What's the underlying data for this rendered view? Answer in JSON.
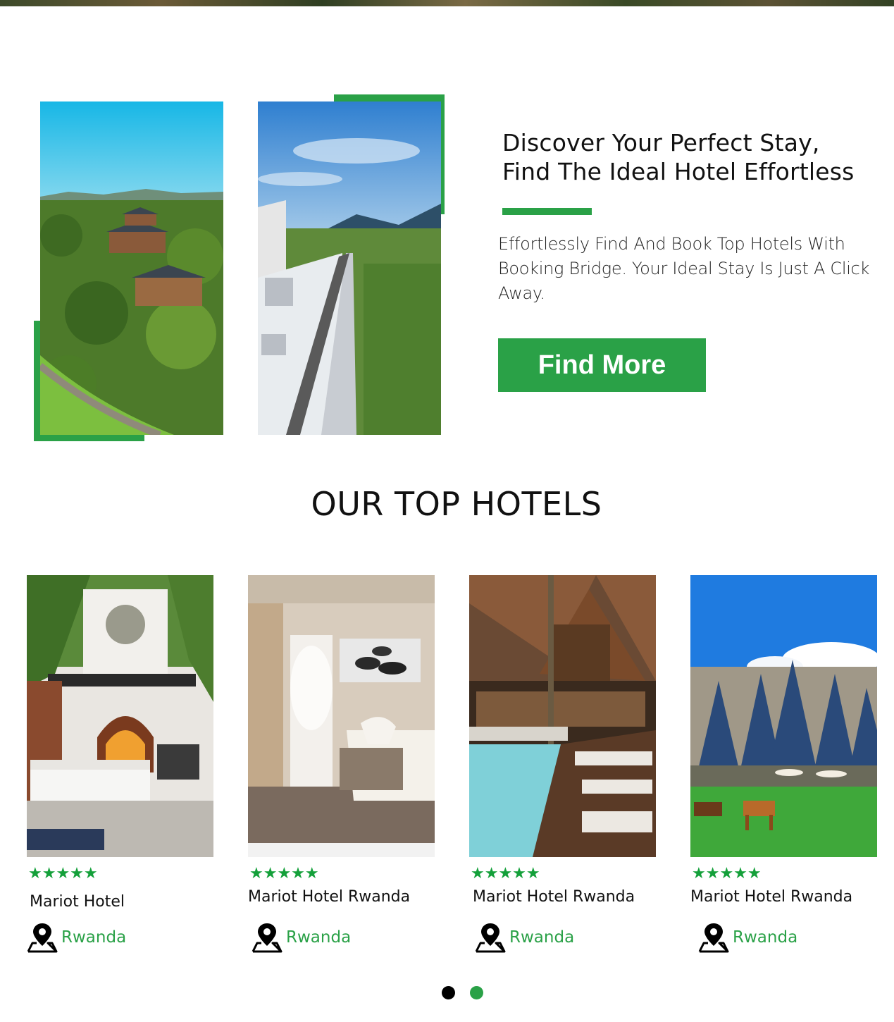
{
  "hero": {
    "title": "Discover Your Perfect Stay, Find The Ideal Hotel Effortless",
    "description": "Effortlessly Find And Book Top Hotels With Booking Bridge. Your Ideal Stay Is Just A Click Away.",
    "cta_label": "Find More"
  },
  "section": {
    "title": "OUR TOP HOTELS"
  },
  "hotels": [
    {
      "name": "Mariot Hotel",
      "rating": "★★★★★",
      "location": "Rwanda"
    },
    {
      "name": "Mariot Hotel Rwanda",
      "rating": "★★★★★",
      "location": "Rwanda"
    },
    {
      "name": "Mariot Hotel Rwanda",
      "rating": "★★★★★",
      "location": "Rwanda"
    },
    {
      "name": "Mariot Hotel Rwanda",
      "rating": "★★★★★",
      "location": "Rwanda"
    }
  ],
  "carousel": {
    "pages": 2,
    "active_page": 2
  },
  "colors": {
    "accent": "#2aa147",
    "star": "#14a03a",
    "dot_inactive": "#000000"
  }
}
